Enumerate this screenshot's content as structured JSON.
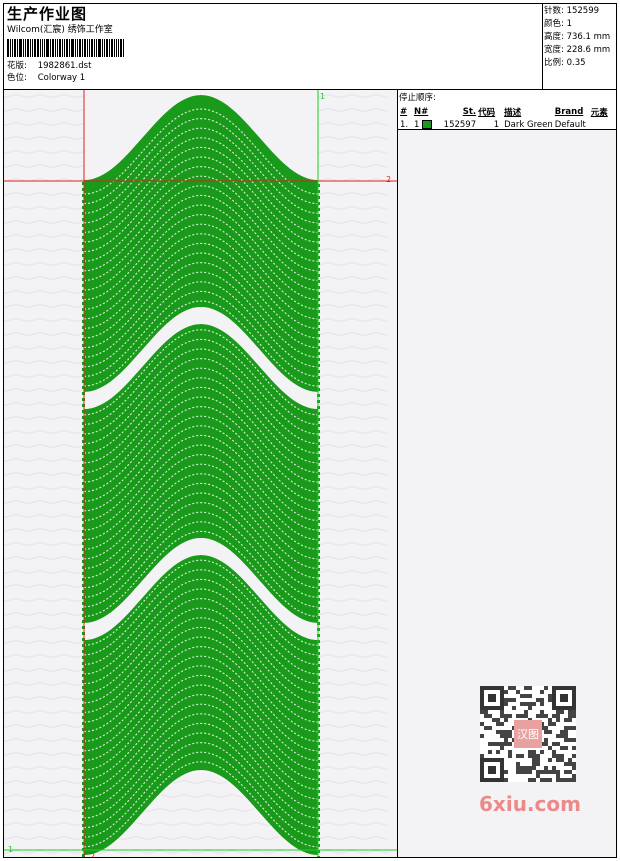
{
  "header": {
    "title": "生产作业图",
    "studio": "Wilcom(汇宸) 绣饰工作室",
    "file_label": "花版:",
    "file_value": "1982861.dst",
    "colorway_label": "色位:",
    "colorway_value": "Colorway 1"
  },
  "specs": [
    {
      "label": "针数:",
      "value": "152599"
    },
    {
      "label": "颜色:",
      "value": "1"
    },
    {
      "label": "高度:",
      "value": "736.1 mm"
    },
    {
      "label": "宽度:",
      "value": "228.6 mm"
    },
    {
      "label": "比例:",
      "value": "0.35"
    }
  ],
  "design": {
    "thread_color": "#1a9a1a",
    "guide_red": "#e02020",
    "guide_green": "#22cc22",
    "markers": {
      "top_right": "1",
      "mid_right": "2",
      "bottom_left": "1",
      "bottom_mid": "2"
    }
  },
  "stop_sequence": {
    "heading": "停止顺序:",
    "columns": [
      "#",
      "N#",
      "St.",
      "代码",
      "描述",
      "Brand",
      "元素"
    ],
    "rows": [
      {
        "idx": "1.",
        "n": "1",
        "color": "#1a9a1a",
        "stitches": "152597",
        "code": "1",
        "desc": "Dark Green",
        "brand": "Default",
        "element": ""
      }
    ]
  },
  "watermark": {
    "text": "6xiu.com",
    "seal_text": "汉图"
  }
}
